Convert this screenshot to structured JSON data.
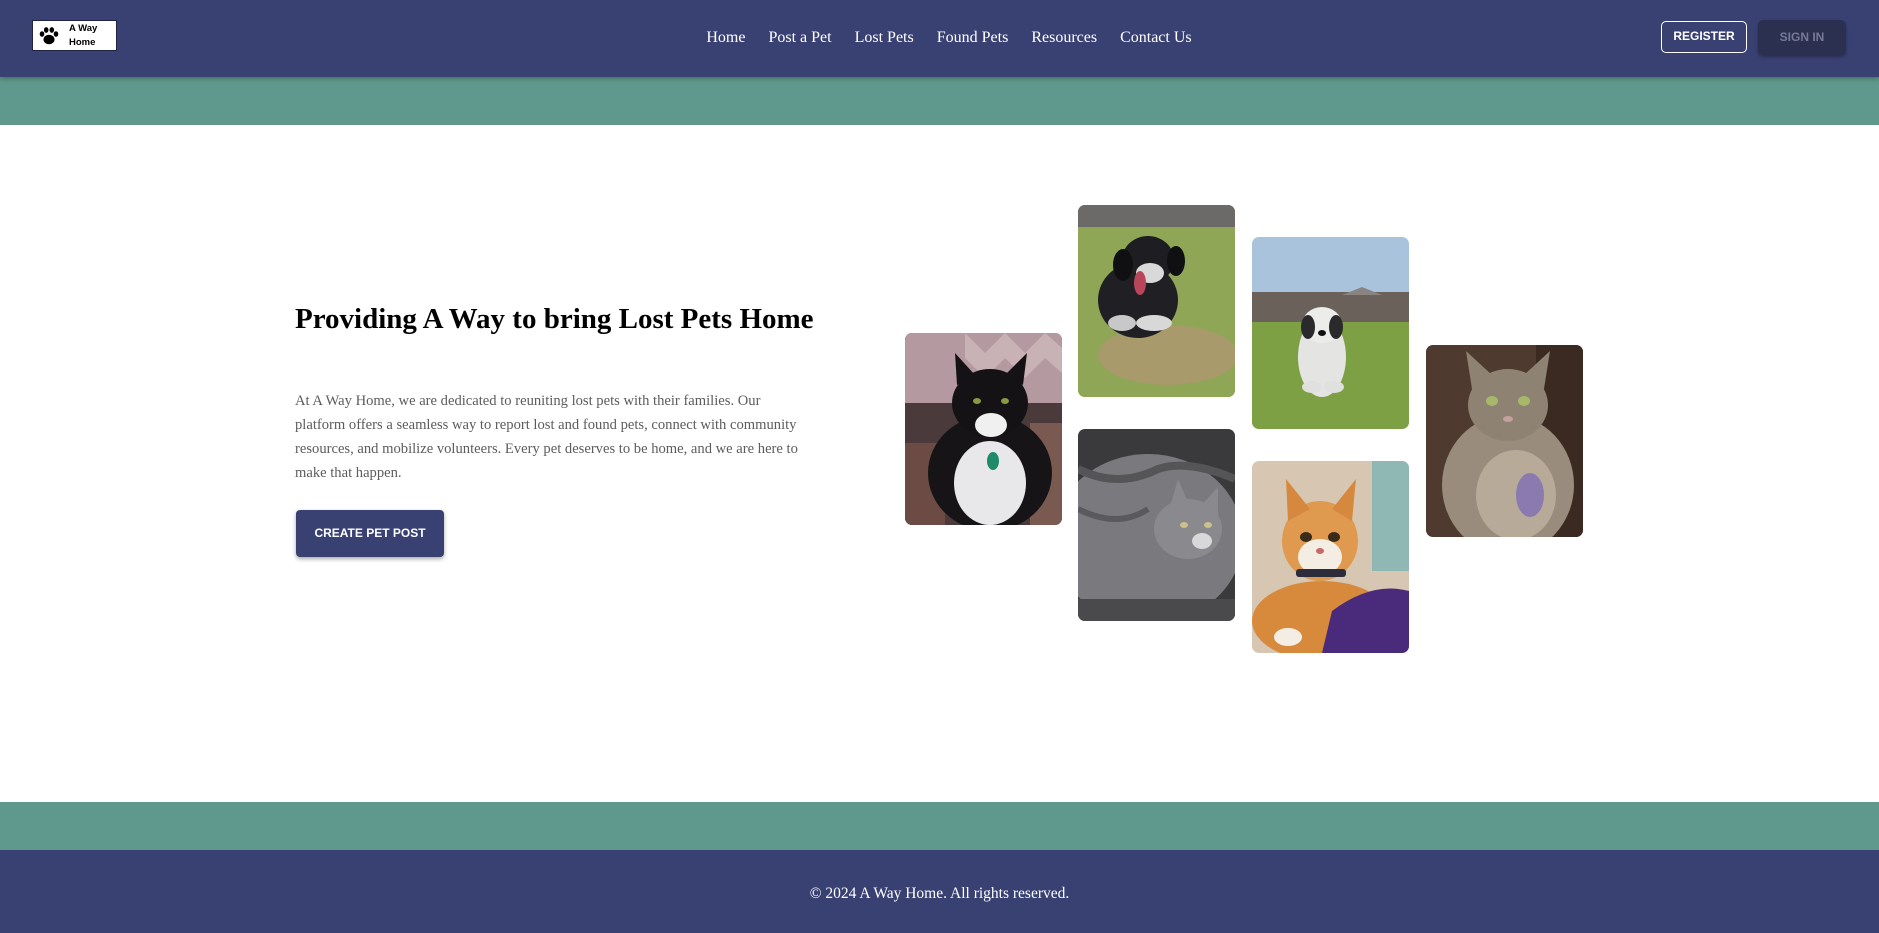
{
  "header": {
    "logo_text": "A Way Home",
    "nav": [
      {
        "label": "Home"
      },
      {
        "label": "Post a Pet"
      },
      {
        "label": "Lost Pets"
      },
      {
        "label": "Found Pets"
      },
      {
        "label": "Resources"
      },
      {
        "label": "Contact Us"
      }
    ],
    "register_label": "REGISTER",
    "signin_label": "SIGN IN"
  },
  "hero": {
    "title": "Providing A Way to bring Lost Pets Home",
    "description": "At A Way Home, we are dedicated to reuniting lost pets with their families. Our platform offers a seamless way to report lost and found pets, connect with community resources, and mobilize volunteers. Every pet deserves to be home, and we are here to make that happen.",
    "cta_label": "CREATE PET POST"
  },
  "gallery": {
    "photos": [
      {
        "subject": "black-and-white-cat"
      },
      {
        "subject": "black-and-white-dog-on-grass"
      },
      {
        "subject": "gray-tabby-cat"
      },
      {
        "subject": "fluffy-white-dog-on-grass"
      },
      {
        "subject": "orange-and-white-cat"
      },
      {
        "subject": "long-haired-gray-cat"
      }
    ]
  },
  "footer": {
    "copyright": "© 2024 A Way Home. All rights reserved."
  },
  "colors": {
    "primary": "#394173",
    "accent_band": "#5f988c",
    "text_muted": "#5c5c5c"
  }
}
